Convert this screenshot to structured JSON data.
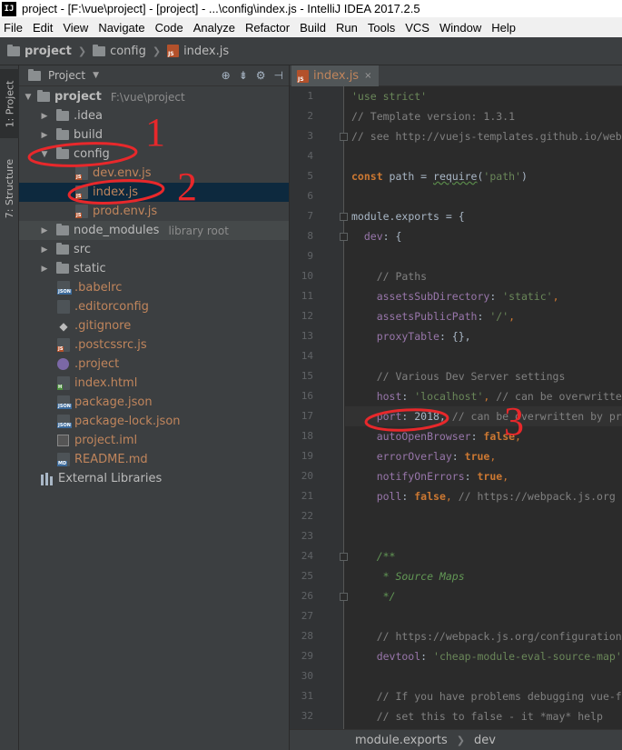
{
  "window": {
    "app_icon_label": "IJ",
    "title": "project - [F:\\vue\\project] - [project] - ...\\config\\index.js - IntelliJ IDEA 2017.2.5"
  },
  "menu": [
    "File",
    "Edit",
    "View",
    "Navigate",
    "Code",
    "Analyze",
    "Refactor",
    "Build",
    "Run",
    "Tools",
    "VCS",
    "Window",
    "Help"
  ],
  "navbar": {
    "crumbs": [
      "project",
      "config",
      "index.js"
    ]
  },
  "toolstrip": {
    "project_tab": "1: Project",
    "structure_tab": "7: Structure"
  },
  "project_panel": {
    "header": "Project",
    "tree": [
      {
        "label": "project",
        "hint": "F:\\vue\\project",
        "type": "folder",
        "state": "expanded"
      },
      {
        "label": ".idea",
        "type": "folder",
        "state": "collapsed"
      },
      {
        "label": "build",
        "type": "folder",
        "state": "collapsed"
      },
      {
        "label": "config",
        "type": "folder",
        "state": "expanded"
      },
      {
        "label": "dev.env.js",
        "type": "js"
      },
      {
        "label": "index.js",
        "type": "js",
        "selected": true
      },
      {
        "label": "prod.env.js",
        "type": "js"
      },
      {
        "label": "node_modules",
        "hint": "library root",
        "type": "folder",
        "state": "collapsed"
      },
      {
        "label": "src",
        "type": "folder",
        "state": "collapsed"
      },
      {
        "label": "static",
        "type": "folder",
        "state": "collapsed"
      },
      {
        "label": ".babelrc",
        "type": "json"
      },
      {
        "label": ".editorconfig",
        "type": "text"
      },
      {
        "label": ".gitignore",
        "type": "git"
      },
      {
        "label": ".postcssrc.js",
        "type": "js"
      },
      {
        "label": ".project",
        "type": "project"
      },
      {
        "label": "index.html",
        "type": "html"
      },
      {
        "label": "package.json",
        "type": "json"
      },
      {
        "label": "package-lock.json",
        "type": "json"
      },
      {
        "label": "project.iml",
        "type": "iml"
      },
      {
        "label": "README.md",
        "type": "md"
      },
      {
        "label": "External Libraries",
        "type": "libraries"
      }
    ]
  },
  "editor": {
    "tab_label": "index.js",
    "tab_close": "×",
    "line_numbers": [
      "1",
      "2",
      "3",
      "4",
      "5",
      "6",
      "7",
      "8",
      "9",
      "10",
      "11",
      "12",
      "13",
      "14",
      "15",
      "16",
      "17",
      "18",
      "19",
      "20",
      "21",
      "22",
      "23",
      "24",
      "25",
      "26",
      "27",
      "28",
      "29",
      "30",
      "31",
      "32"
    ],
    "lines": {
      "l1": "'use strict'",
      "l2": "// Template version: 1.3.1",
      "l3": "// see http://vuejs-templates.github.io/web",
      "l5a": "const",
      "l5b": " path = ",
      "l5c": "require",
      "l5d": "(",
      "l5e": "'path'",
      "l5f": ")",
      "l7a": "module",
      "l7b": ".",
      "l7c": "exports",
      "l7d": " = {",
      "l8a": "  dev",
      "l8b": ": {",
      "l10": "    // Paths",
      "l11a": "    assetsSubDirectory",
      "l11b": ": ",
      "l11c": "'static'",
      "l11d": ",",
      "l12a": "    assetsPublicPath",
      "l12b": ": ",
      "l12c": "'/'",
      "l12d": ",",
      "l13a": "    proxyTable",
      "l13b": ": {},",
      "l15": "    // Various Dev Server settings",
      "l16a": "    host",
      "l16b": ": ",
      "l16c": "'localhost'",
      "l16d": ", ",
      "l16e": "// can be overwritte",
      "l17a": "    port",
      "l17b": ": 2018, ",
      "l17c": "// can be overwritten by pr",
      "l18a": "    autoOpenBrowser",
      "l18b": ": ",
      "l18c": "false",
      "l18d": ",",
      "l19a": "    errorOverlay",
      "l19b": ": ",
      "l19c": "true",
      "l19d": ",",
      "l20a": "    notifyOnErrors",
      "l20b": ": ",
      "l20c": "true",
      "l20d": ",",
      "l21a": "    poll",
      "l21b": ": ",
      "l21c": "false",
      "l21d": ", ",
      "l21e": "// https://webpack.js.org",
      "l25": "    /**",
      "l26": "     * Source Maps",
      "l27": "     */",
      "l29": "    // https://webpack.js.org/configuration",
      "l30a": "    devtool",
      "l30b": ": ",
      "l30c": "'cheap-module-eval-source-map'",
      "l32": "    // If you have problems debugging vue-f",
      "l33": "    // set this to false - it *may* help"
    },
    "breadcrumb": [
      "module.exports",
      "dev"
    ]
  },
  "annotations": {
    "n1": "1",
    "n2": "2",
    "n3": "3",
    "color": "#e8282b"
  }
}
